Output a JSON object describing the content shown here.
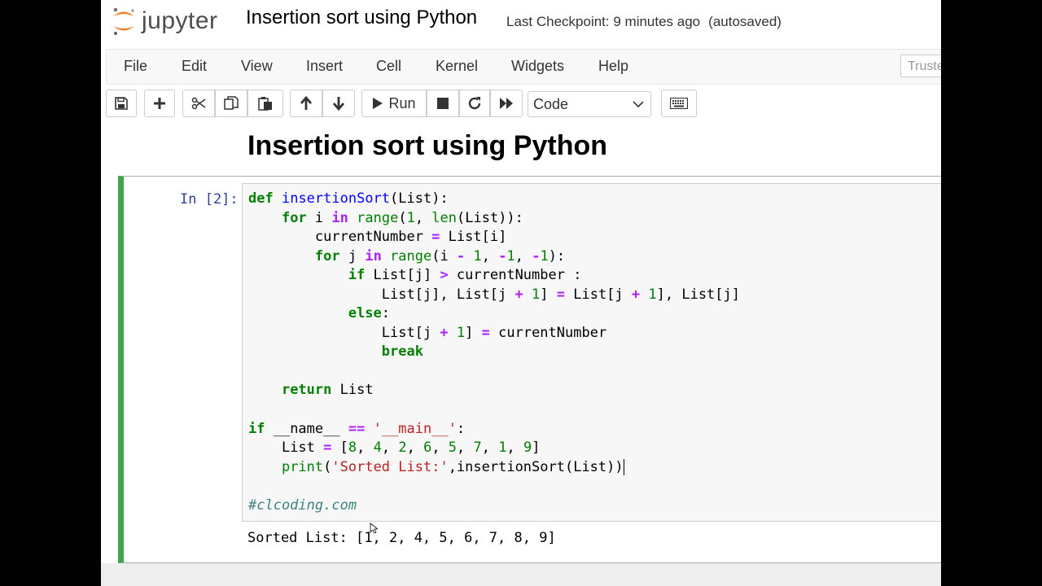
{
  "app": {
    "logo_text": "jupyter"
  },
  "notebook": {
    "title": "Insertion sort using Python",
    "checkpoint": "Last Checkpoint: 9 minutes ago",
    "autosaved": "(autosaved)",
    "trusted": "Truste"
  },
  "menu": [
    "File",
    "Edit",
    "View",
    "Insert",
    "Cell",
    "Kernel",
    "Widgets",
    "Help"
  ],
  "toolbar": {
    "run_label": "Run",
    "cell_type": "Code",
    "icons": [
      "save-icon",
      "plus-icon",
      "cut-icon",
      "copy-icon",
      "paste-icon",
      "arrow-up-icon",
      "arrow-down-icon",
      "run-icon",
      "stop-icon",
      "restart-icon",
      "fast-forward-icon",
      "keyboard-icon"
    ]
  },
  "heading": "Insertion sort using Python",
  "cell": {
    "prompt": "In [2]:",
    "output": "Sorted List: [1, 2, 4, 5, 6, 7, 8, 9]"
  },
  "colors": {
    "accent_green": "#42a54b",
    "prompt_blue": "#303f9f"
  }
}
